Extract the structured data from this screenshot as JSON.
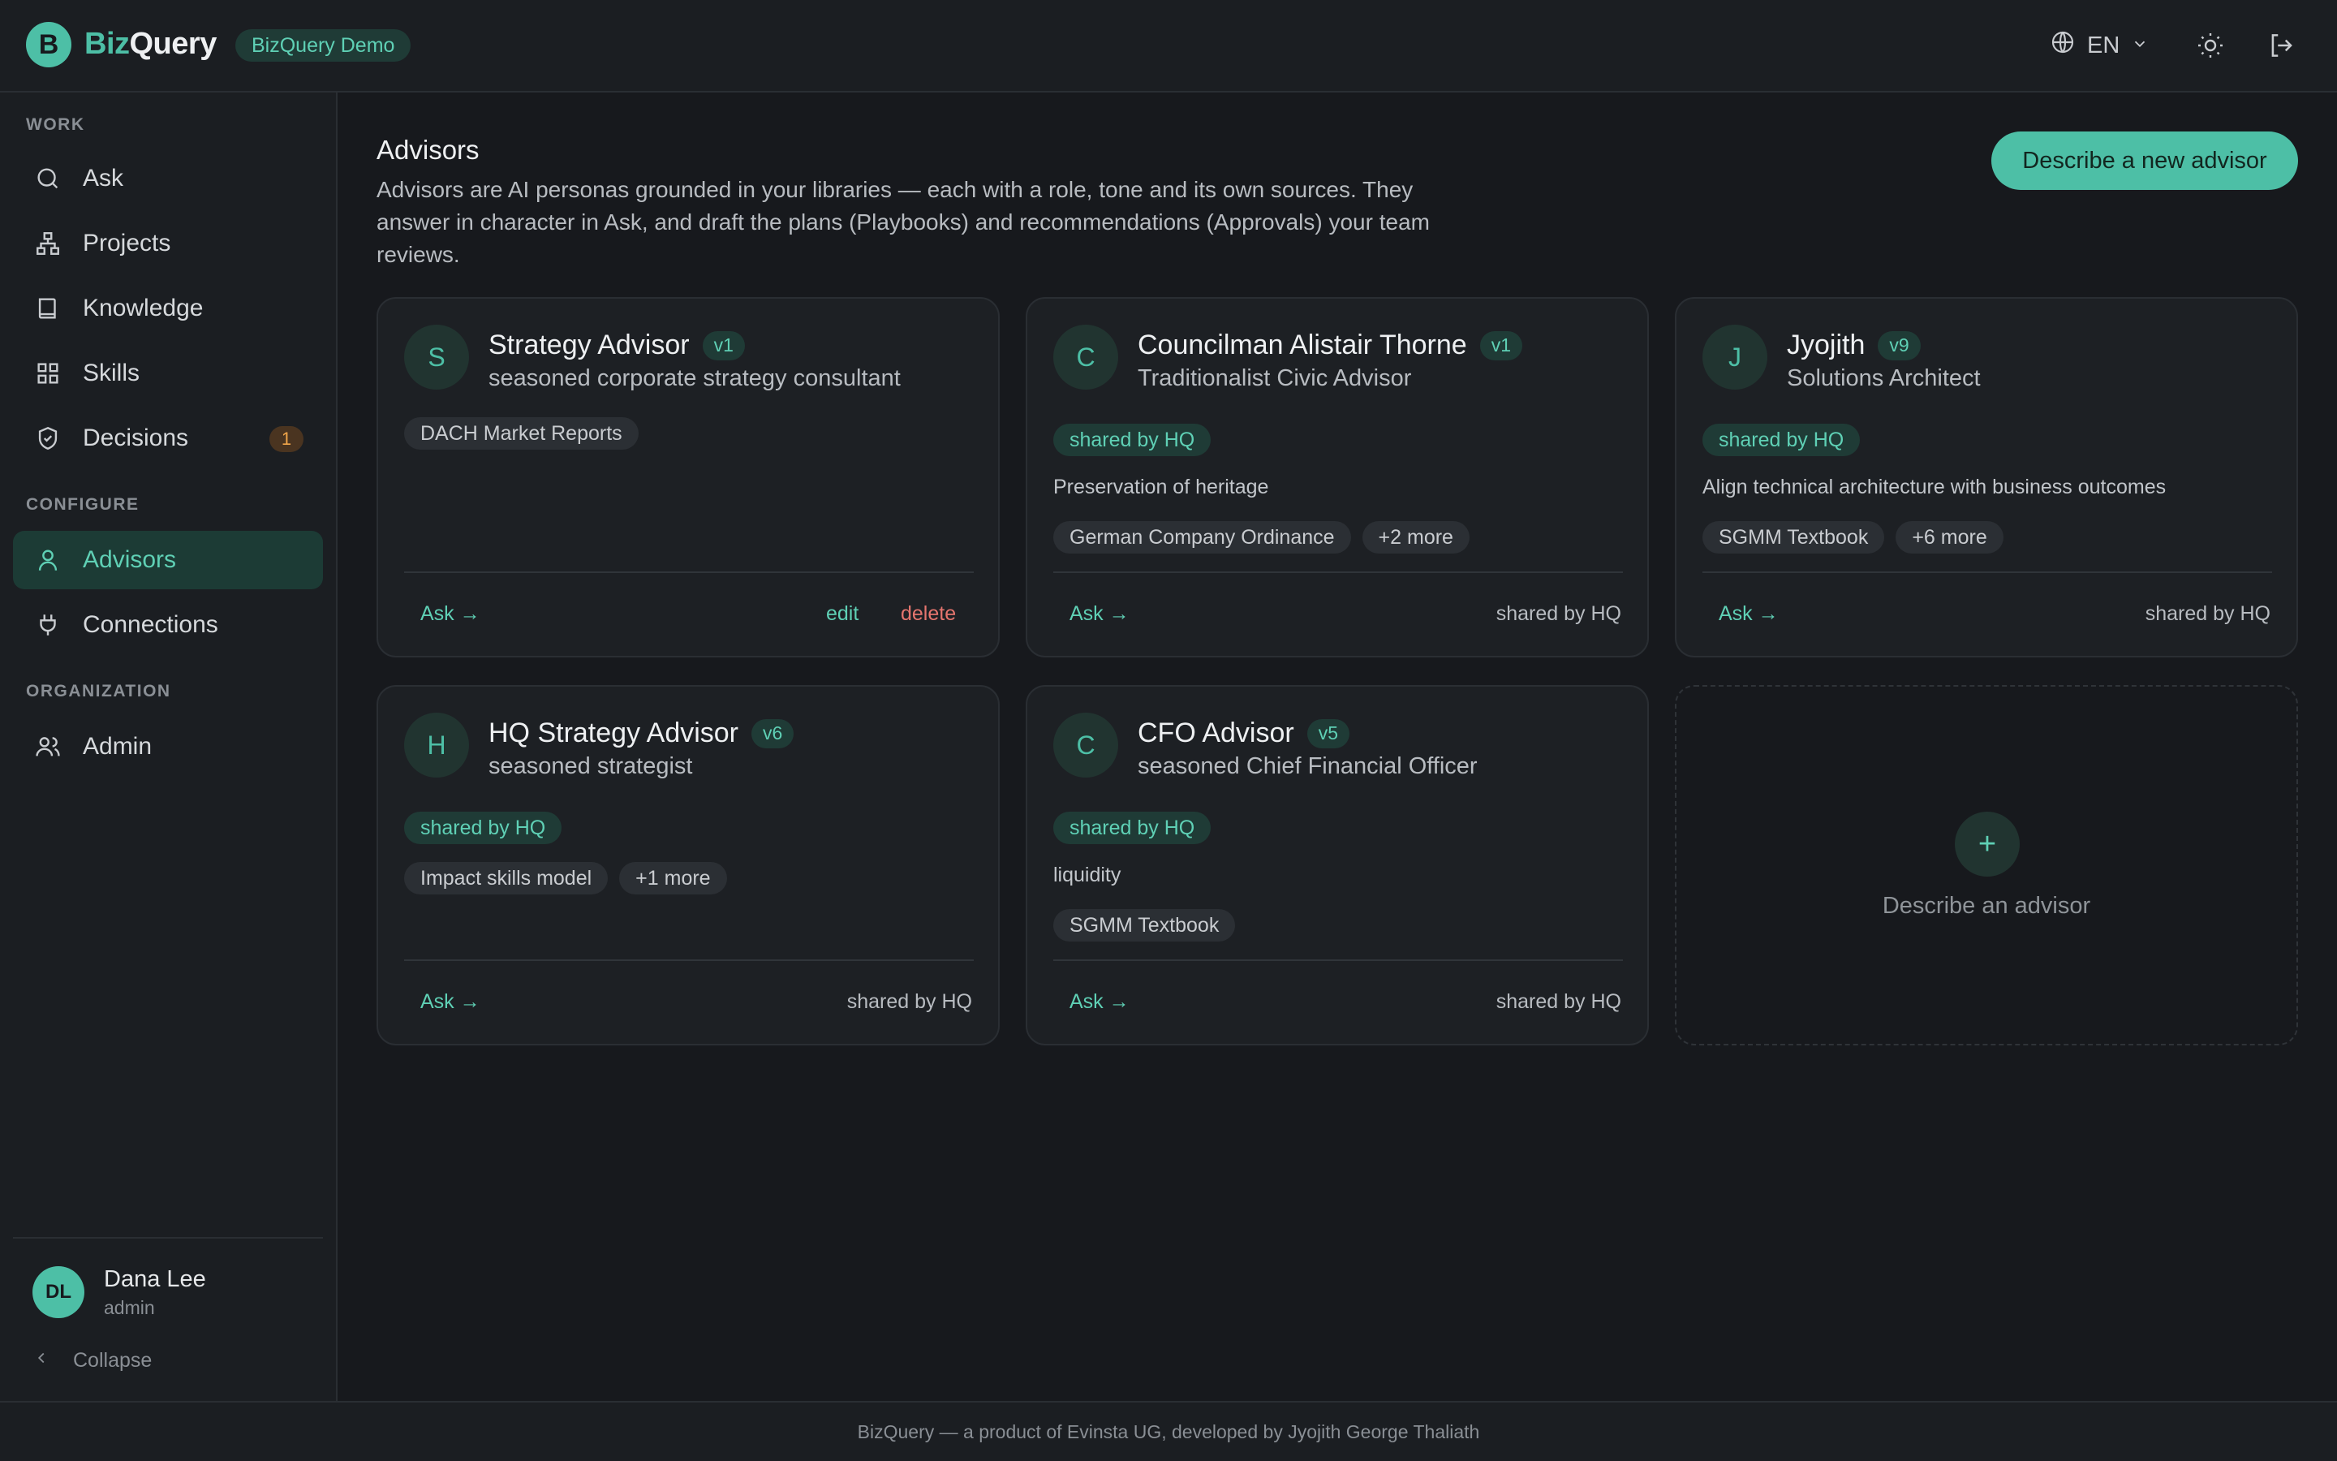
{
  "header": {
    "logo_letter": "B",
    "logo_biz": "Biz",
    "logo_query": "Query",
    "workspace_badge": "BizQuery Demo",
    "language": "EN",
    "icons": [
      "globe-icon",
      "chevron-down-icon",
      "sun-icon",
      "logout-icon"
    ]
  },
  "sidebar": {
    "sections": {
      "work": "WORK",
      "configure": "CONFIGURE",
      "organization": "ORGANIZATION"
    },
    "items": [
      {
        "label": "Ask",
        "icon": "search-icon"
      },
      {
        "label": "Projects",
        "icon": "hierarchy-icon"
      },
      {
        "label": "Knowledge",
        "icon": "book-icon"
      },
      {
        "label": "Skills",
        "icon": "grid-icon"
      },
      {
        "label": "Decisions",
        "icon": "shield-check-icon",
        "badge": "1"
      },
      {
        "label": "Advisors",
        "icon": "user-icon",
        "active": true
      },
      {
        "label": "Connections",
        "icon": "plug-icon"
      },
      {
        "label": "Admin",
        "icon": "users-icon"
      }
    ],
    "user": {
      "initials": "DL",
      "name": "Dana Lee",
      "role": "admin"
    },
    "collapse_label": "Collapse"
  },
  "main": {
    "title": "Advisors",
    "description": "Advisors are AI personas grounded in your libraries — each with a role, tone and its own sources. They answer in character in Ask, and draft the plans (Playbooks) and recommendations (Approvals) your team reviews.",
    "new_button": "Describe a new advisor",
    "add_card_label": "Describe an advisor",
    "add_card_plus": "+",
    "cards": [
      {
        "initial": "S",
        "name": "Strategy Advisor",
        "version": "v1",
        "role": "seasoned corporate strategy consultant",
        "sources": [
          "DACH Market Reports"
        ],
        "ask": "Ask →",
        "edit": "edit",
        "delete": "delete"
      },
      {
        "initial": "C",
        "name": "Councilman Alistair Thorne",
        "version": "v1",
        "role": "Traditionalist Civic Advisor",
        "shared": "shared by HQ",
        "focus": "Preservation of heritage",
        "sources": [
          "German Company Ordinance",
          "+2 more"
        ],
        "ask": "Ask →",
        "footer": "shared by HQ"
      },
      {
        "initial": "J",
        "name": "Jyojith",
        "version": "v9",
        "role": "Solutions Architect",
        "shared": "shared by HQ",
        "focus": "Align technical architecture with business outcomes",
        "sources": [
          "SGMM Textbook",
          "+6 more"
        ],
        "ask": "Ask →",
        "footer": "shared by HQ"
      },
      {
        "initial": "H",
        "name": "HQ Strategy Advisor",
        "version": "v6",
        "role": "seasoned strategist",
        "shared": "shared by HQ",
        "sources": [
          "Impact skills model",
          "+1 more"
        ],
        "ask": "Ask →",
        "footer": "shared by HQ"
      },
      {
        "initial": "C",
        "name": "CFO Advisor",
        "version": "v5",
        "role": "seasoned Chief Financial Officer",
        "shared": "shared by HQ",
        "focus": "liquidity",
        "sources": [
          "SGMM Textbook"
        ],
        "ask": "Ask →",
        "footer": "shared by HQ"
      }
    ]
  },
  "footer": {
    "text": "BizQuery — a product of Evinsta UG, developed by Jyojith George Thaliath"
  },
  "colors": {
    "accent": "#4dbfa6",
    "background": "#17191d",
    "surface": "#1d2024",
    "danger": "#e5756e",
    "warning": "#f0a54a"
  }
}
